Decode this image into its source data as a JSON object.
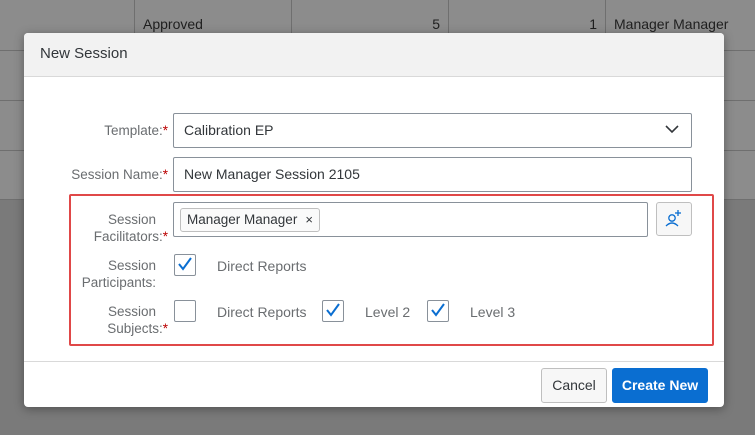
{
  "background_table": {
    "row": {
      "status": "Approved",
      "num1": "5",
      "num2": "1",
      "manager": "Manager Manager"
    }
  },
  "dialog": {
    "title": "New Session",
    "template": {
      "label": "Template:",
      "value": "Calibration EP"
    },
    "session_name": {
      "label": "Session Name:",
      "value": "New Manager Session 2105"
    },
    "facilitators": {
      "label_line1": "Session",
      "label_line2": "Facilitators:",
      "tokens": [
        "Manager Manager"
      ],
      "remove_glyph": "×",
      "add_icon": "add-person-icon"
    },
    "participants": {
      "label_line1": "Session",
      "label_line2": "Participants:",
      "options": [
        {
          "label": "Direct Reports",
          "checked": true
        }
      ]
    },
    "subjects": {
      "label_line1": "Session",
      "label_line2": "Subjects:",
      "options": [
        {
          "label": "Direct Reports",
          "checked": false
        },
        {
          "label": "Level 2",
          "checked": true
        },
        {
          "label": "Level 3",
          "checked": true
        }
      ]
    },
    "required_marker": "*",
    "buttons": {
      "cancel": "Cancel",
      "create": "Create New"
    }
  },
  "colors": {
    "accent": "#0a6ed1",
    "required": "#bb0000",
    "highlight": "#e04848",
    "check": "#0a6ed1"
  }
}
